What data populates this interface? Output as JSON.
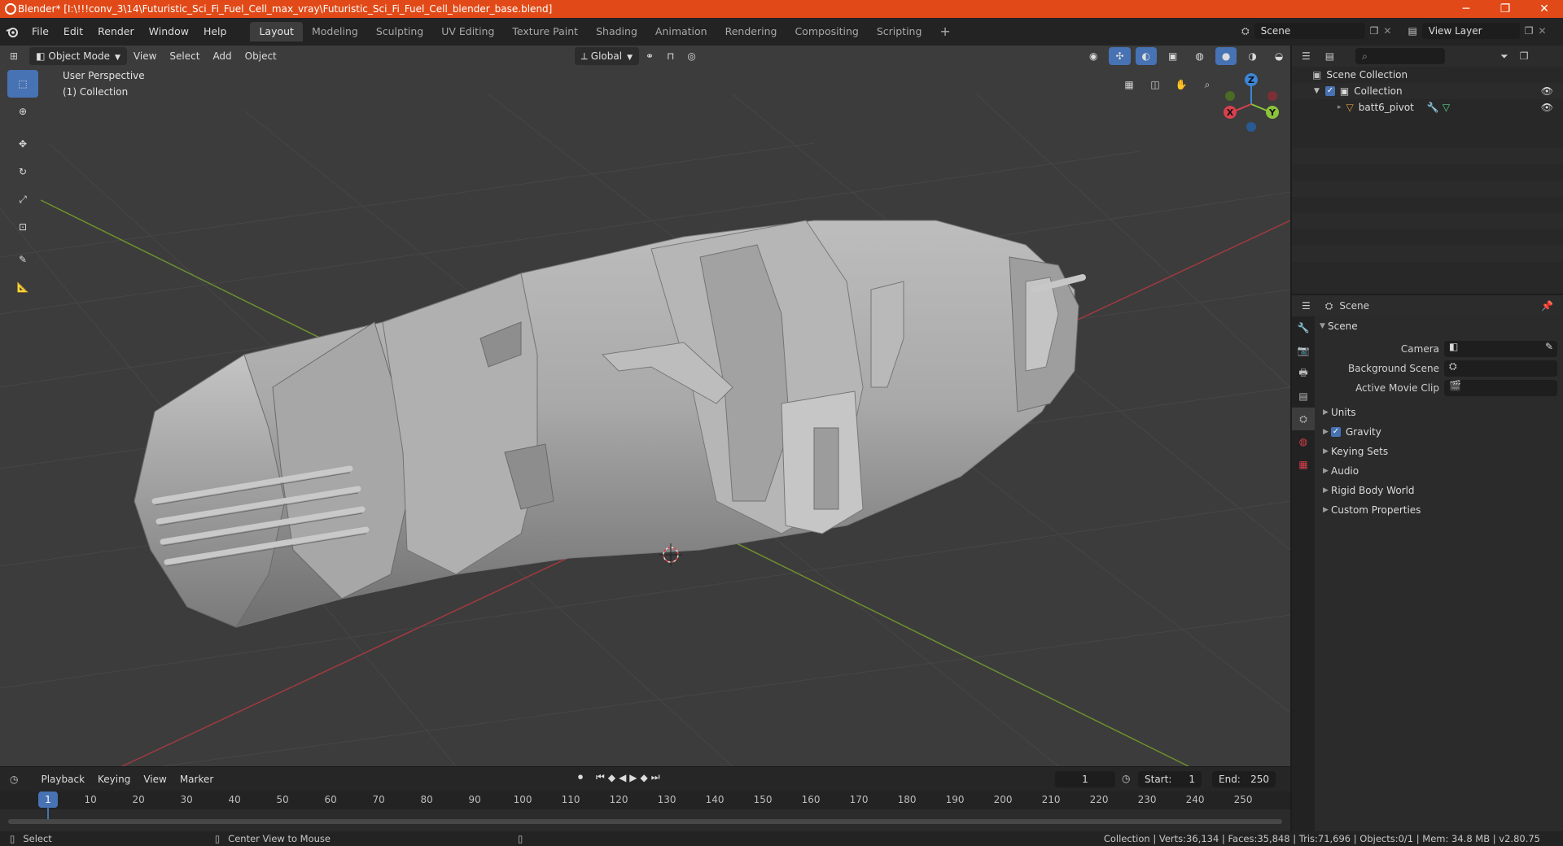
{
  "window": {
    "title": "Blender* [I:\\!!!conv_3\\14\\Futuristic_Sci_Fi_Fuel_Cell_max_vray\\Futuristic_Sci_Fi_Fuel_Cell_blender_base.blend]",
    "minimize": "─",
    "restore": "❐",
    "close": "✕"
  },
  "menu": [
    "File",
    "Edit",
    "Render",
    "Window",
    "Help"
  ],
  "workspaces": [
    "Layout",
    "Modeling",
    "Sculpting",
    "UV Editing",
    "Texture Paint",
    "Shading",
    "Animation",
    "Rendering",
    "Compositing",
    "Scripting"
  ],
  "workspace_add": "+",
  "scene_field": "Scene",
  "view_layer_field": "View Layer",
  "viewport": {
    "mode": "Object Mode",
    "menus": [
      "View",
      "Select",
      "Add",
      "Object"
    ],
    "orientation": "Global",
    "perspective_label": "User Perspective",
    "collection_label": "(1) Collection",
    "gizmo": {
      "x": "X",
      "y": "Y",
      "z": "Z"
    }
  },
  "outliner": {
    "root": "Scene Collection",
    "collection": "Collection",
    "object": "batt6_pivot"
  },
  "properties": {
    "header_scene": "Scene",
    "panel_title": "Scene",
    "rows": [
      {
        "label": "Camera"
      },
      {
        "label": "Background Scene"
      },
      {
        "label": "Active Movie Clip"
      }
    ],
    "subpanels": [
      "Units",
      "Gravity",
      "Keying Sets",
      "Audio",
      "Rigid Body World",
      "Custom Properties"
    ],
    "gravity_checked": true
  },
  "timeline": {
    "menus": [
      "Playback",
      "Keying",
      "View",
      "Marker"
    ],
    "current_frame": "1",
    "start_label": "Start:",
    "start": "1",
    "end_label": "End:",
    "end": "250",
    "ruler_marks": [
      "1",
      "10",
      "20",
      "30",
      "40",
      "50",
      "60",
      "70",
      "80",
      "90",
      "100",
      "110",
      "120",
      "130",
      "140",
      "150",
      "160",
      "170",
      "180",
      "190",
      "200",
      "210",
      "220",
      "230",
      "240",
      "250"
    ]
  },
  "status": {
    "select": "Select",
    "center": "Center View to Mouse",
    "stats": "Collection | Verts:36,134 | Faces:35,848 | Tris:71,696 | Objects:0/1 | Mem: 34.8 MB | v2.80.75"
  },
  "colors": {
    "accent": "#4772b3",
    "titlebar": "#e14a18",
    "x_axis": "#d9404d",
    "y_axis": "#8bc43a",
    "z_axis": "#3b86d8"
  }
}
